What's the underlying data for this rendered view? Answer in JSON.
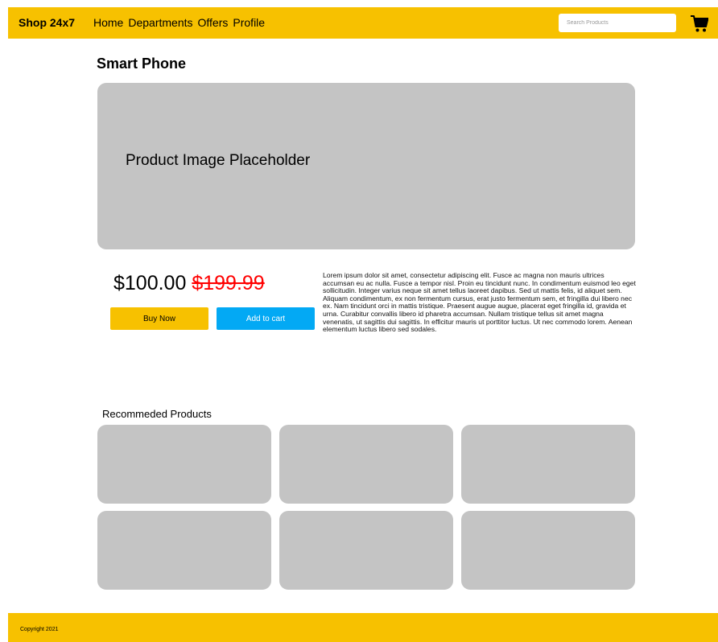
{
  "navbar": {
    "brand": "Shop 24x7",
    "links": [
      "Home",
      "Departments",
      "Offers",
      "Profile"
    ],
    "search_placeholder": "Search Products",
    "cart_icon": "shopping-cart-icon",
    "color": "#f7c100"
  },
  "product": {
    "title": "Smart Phone",
    "image_placeholder": "Product Image Placeholder",
    "price": "$100.00",
    "old_price": "$199.99",
    "buy_label": "Buy Now",
    "cart_label": "Add to cart",
    "description": "Lorem ipsum dolor sit amet, consectetur adipiscing elit. Fusce ac magna non mauris ultrices accumsan eu ac nulla. Fusce a tempor nisl. Proin eu tincidunt nunc. In condimentum euismod leo eget sollicitudin. Integer varius neque sit amet tellus laoreet dapibus. Sed ut mattis felis, id aliquet sem. Aliquam condimentum, ex non fermentum cursus, erat justo fermentum sem, et fringilla dui libero nec ex. Nam tincidunt orci in mattis tristique. Praesent augue augue, placerat eget fringilla id, gravida et urna. Curabitur convallis libero id pharetra accumsan. Nullam tristique tellus sit amet magna venenatis, ut sagittis dui sagittis. In efficitur mauris ut porttitor luctus. Ut nec commodo lorem. Aenean elementum luctus libero sed sodales."
  },
  "recommended": {
    "title": "Recommeded Products"
  },
  "footer": {
    "copyright": "Copyright 2021"
  },
  "colors": {
    "accent": "#f7c100",
    "cart_button": "#03a9f4",
    "old_price": "#ff0000",
    "placeholder": "#c4c4c4"
  }
}
